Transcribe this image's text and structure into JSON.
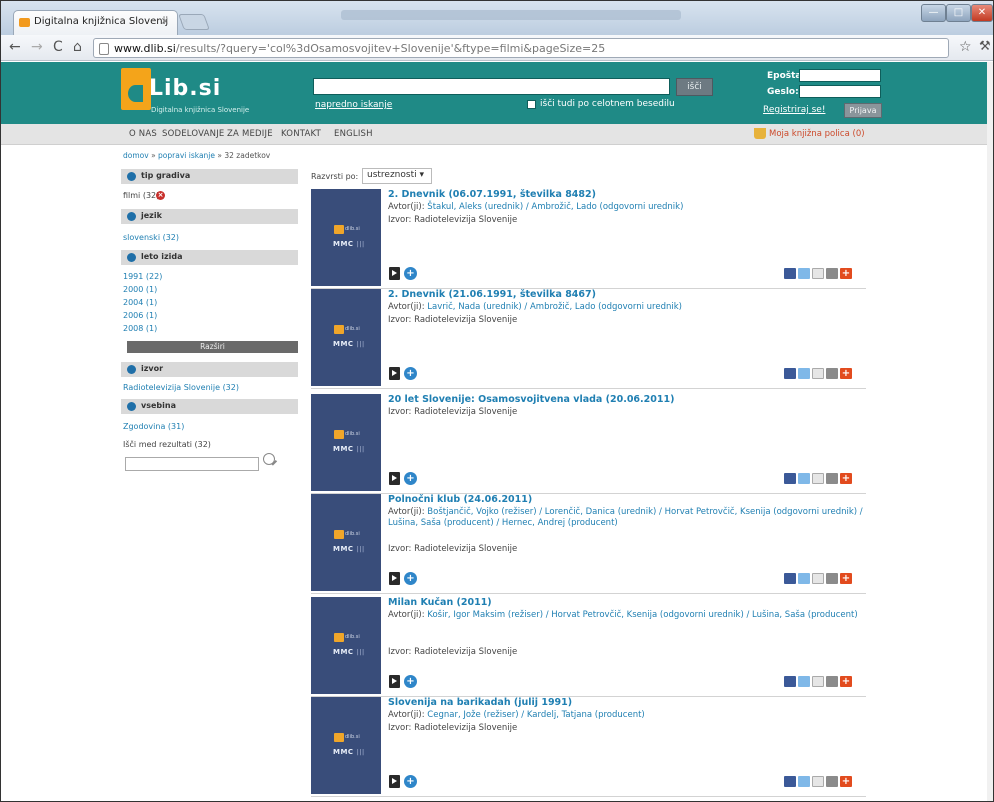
{
  "browser": {
    "tab_title": "Digitalna knjižnica Slovenij",
    "tab_close": "×",
    "url_domain": "www.dlib.si",
    "url_path": "/results/?query='col%3dOsamosvojitev+Slovenije'&ftype=filmi&pageSize=25"
  },
  "header": {
    "logo_text": "Lib.si",
    "logo_subtitle": "Digitalna knjižnica Slovenije",
    "search_button": "išči",
    "advanced_search": "napredno iskanje",
    "fulltext_label": "išči tudi po celotnem besedilu",
    "email_label": "Epošta:",
    "password_label": "Geslo:",
    "register_link": "Registriraj se!",
    "login_button": "Prijava"
  },
  "menu": {
    "items": [
      "O NAS",
      "SODELOVANJE",
      "ZA MEDIJE",
      "KONTAKT",
      "ENGLISH"
    ],
    "shelf": "Moja knjižna polica (0)"
  },
  "breadcrumb": {
    "home": "domov",
    "sep1": " » ",
    "refine": "popravi iskanje",
    "sep2": " » ",
    "count": "32 zadetkov"
  },
  "facets": {
    "type_head": "tip gradiva",
    "type_value": "filmi (32)",
    "lang_head": "jezik",
    "lang_value": "slovenski (32)",
    "year_head": "leto izida",
    "years": [
      "1991 (22)",
      "2000 (1)",
      "2004 (1)",
      "2006 (1)",
      "2008 (1)"
    ],
    "expand": "Razširi",
    "source_head": "izvor",
    "source_value": "Radiotelevizija Slovenije (32)",
    "content_head": "vsebina",
    "content_value": "Zgodovina (31)",
    "refine_label": "Išči med rezultati (32)"
  },
  "sort": {
    "label": "Razvrsti po:",
    "value": "ustreznosti ▾"
  },
  "thumb": {
    "logo_small": "dlib.si",
    "mmc": "MMC"
  },
  "results": [
    {
      "title": "2. Dnevnik (06.07.1991, številka 8482)",
      "authors_label": "Avtor(ji): ",
      "authors": "Štakul, Aleks (urednik) / Ambrožič, Lado (odgovorni urednik)",
      "source": "Izvor: Radiotelevizija Slovenije"
    },
    {
      "title": "2. Dnevnik (21.06.1991, številka 8467)",
      "authors_label": "Avtor(ji): ",
      "authors": "Lavrič, Nada (urednik) / Ambrožič, Lado (odgovorni urednik)",
      "source": "Izvor: Radiotelevizija Slovenije"
    },
    {
      "title": "20 let Slovenije: Osamosvojitvena vlada (20.06.2011)",
      "authors_label": "",
      "authors": "",
      "source": "Izvor: Radiotelevizija Slovenije"
    },
    {
      "title": "Polnočni klub (24.06.2011)",
      "authors_label": "Avtor(ji): ",
      "authors": "Boštjančič, Vojko (režiser) / Lorenčič, Danica (urednik) / Horvat Petrovčič, Ksenija (odgovorni urednik) / Lušina, Saša (producent) / Hernec, Andrej (producent)",
      "source": "Izvor: Radiotelevizija Slovenije"
    },
    {
      "title": "Milan Kučan (2011)",
      "authors_label": "Avtor(ji): ",
      "authors": "Košir, Igor Maksim (režiser) / Horvat Petrovčič, Ksenija (odgovorni urednik) / Lušina, Saša (producent)",
      "source": "Izvor: Radiotelevizija Slovenije"
    },
    {
      "title": "Slovenija na barikadah (julij 1991)",
      "authors_label": "Avtor(ji): ",
      "authors": "Cegnar, Jože (režiser) / Kardelj, Tatjana (producent)",
      "source": "Izvor: Radiotelevizija Slovenije"
    }
  ],
  "colors": {
    "header_teal": "#1f8a86",
    "logo_orange": "#f4a41a",
    "link_blue": "#1f7fb2",
    "thumb_navy": "#394d7a"
  }
}
